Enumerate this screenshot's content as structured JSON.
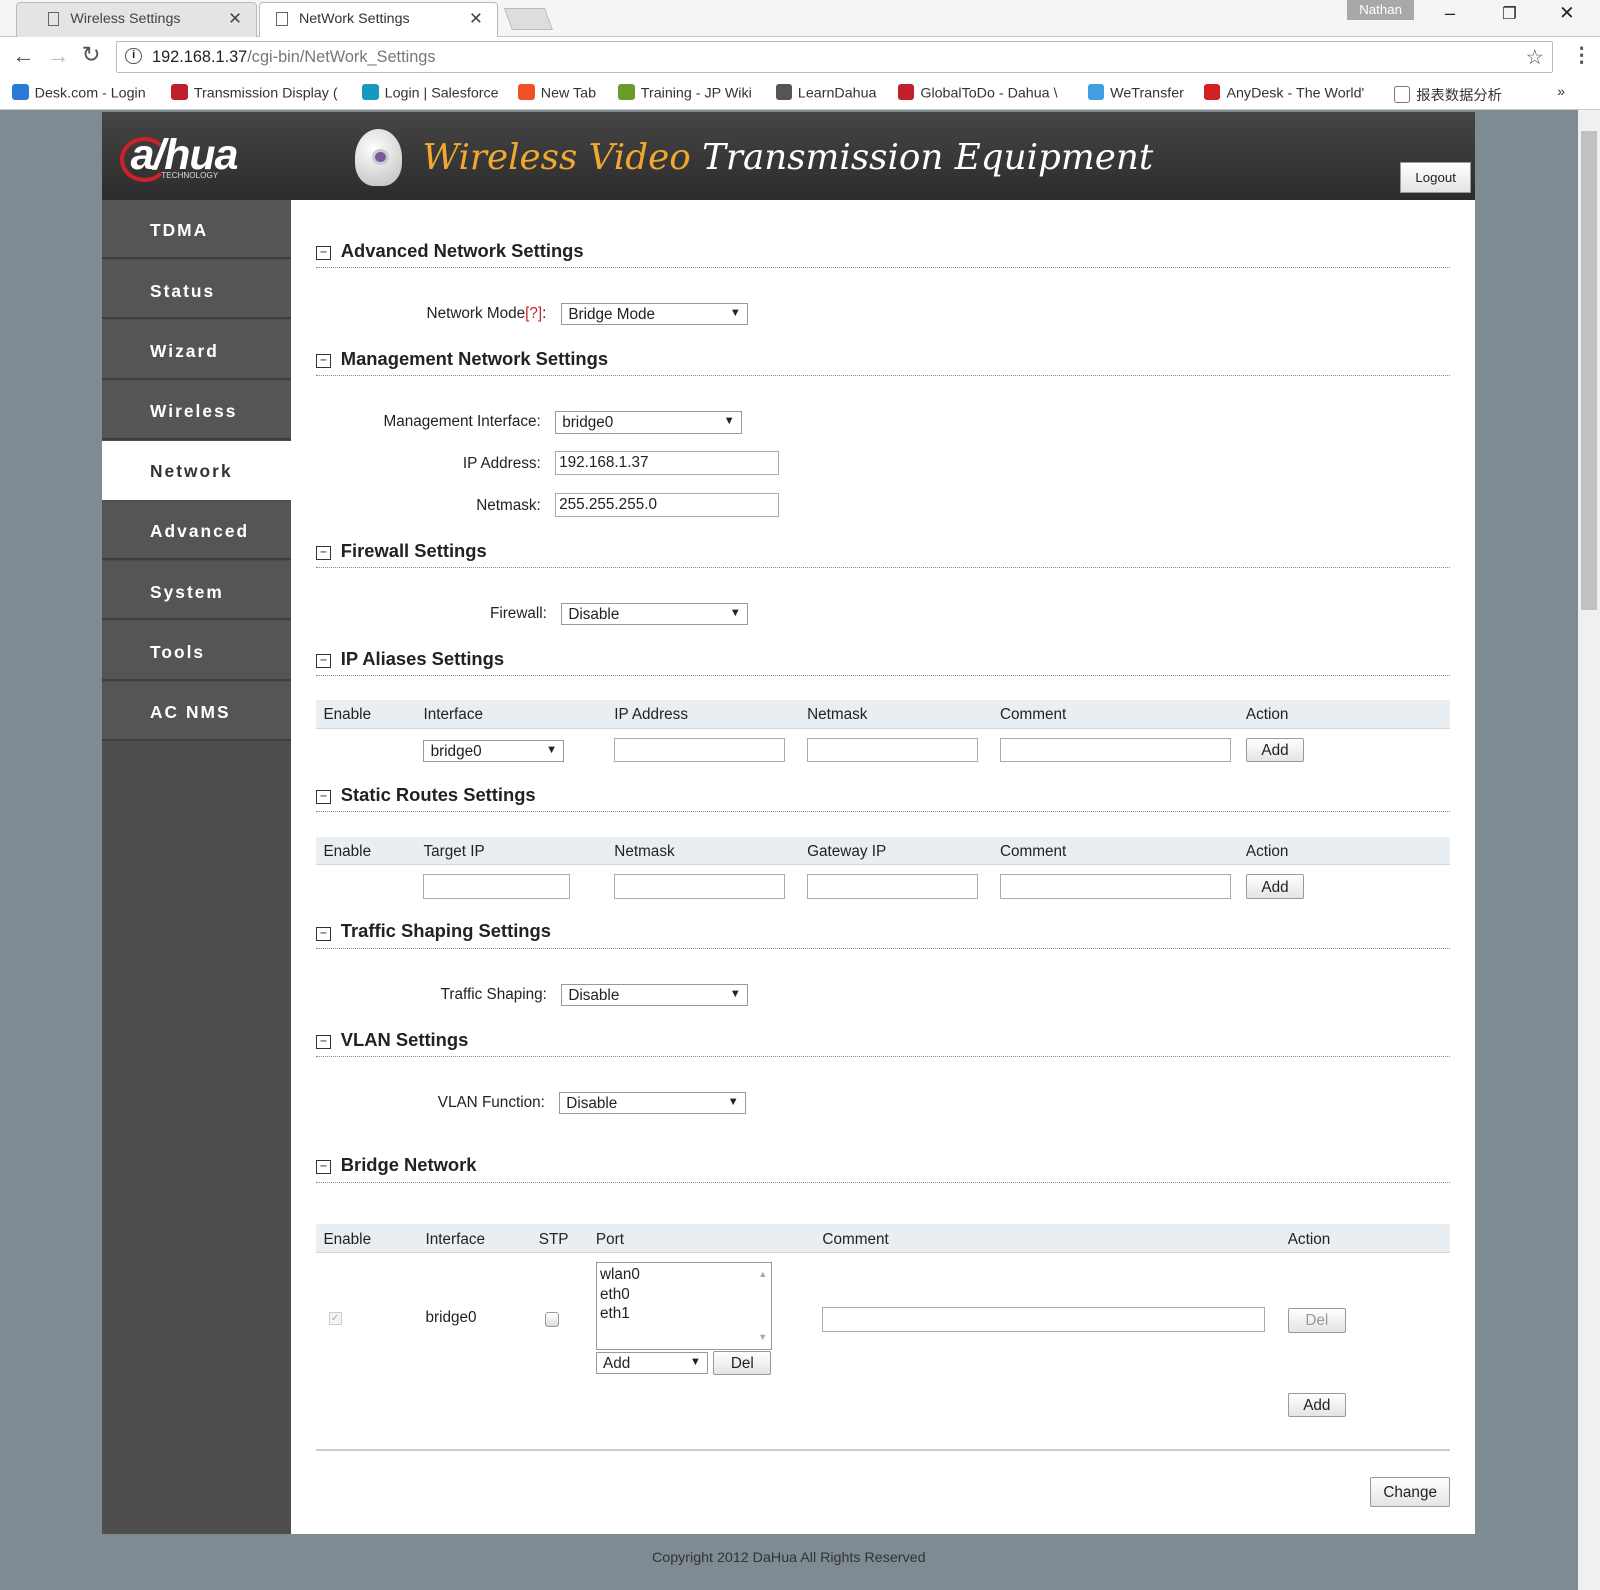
{
  "browser": {
    "tabs": [
      {
        "title": "Wireless Settings",
        "active": false
      },
      {
        "title": "NetWork Settings",
        "active": true
      }
    ],
    "profile": "Nathan",
    "url_host": "192.168.1.37",
    "url_path": "/cgi-bin/NetWork_Settings",
    "bookmarks": [
      {
        "label": "Desk.com - Login",
        "color": "#2b7bd6"
      },
      {
        "label": "Transmission Display (",
        "color": "#c0202a"
      },
      {
        "label": "Login | Salesforce",
        "color": "#1798c1"
      },
      {
        "label": "New Tab",
        "color": "#f25022"
      },
      {
        "label": "Training - JP Wiki",
        "color": "#6a9b2a"
      },
      {
        "label": "LearnDahua",
        "color": "#555555"
      },
      {
        "label": "GlobalToDo - Dahua \\",
        "color": "#c0202a"
      },
      {
        "label": "WeTransfer",
        "color": "#409fe0"
      },
      {
        "label": "AnyDesk - The World'",
        "color": "#d22020"
      },
      {
        "label": "报表数据分析",
        "color": "#ffffff"
      }
    ],
    "more": "»"
  },
  "header": {
    "logo": "alhua",
    "logo_sub": "TECHNOLOGY",
    "title_a": "Wireless Video",
    "title_b": "Transmission Equipment",
    "logout": "Logout",
    "accent": "#f0a830"
  },
  "sidebar": {
    "items": [
      {
        "label": "TDMA"
      },
      {
        "label": "Status"
      },
      {
        "label": "Wizard"
      },
      {
        "label": "Wireless"
      },
      {
        "label": "Network",
        "active": true
      },
      {
        "label": "Advanced"
      },
      {
        "label": "System"
      },
      {
        "label": "Tools"
      },
      {
        "label": "AC NMS"
      }
    ]
  },
  "sections": {
    "advanced": {
      "title": "Advanced Network Settings",
      "mode_label": "Network Mode",
      "help": "[?]",
      "colon": ":",
      "mode_value": "Bridge Mode"
    },
    "management": {
      "title": "Management Network Settings",
      "iface_label": "Management Interface:",
      "iface_value": "bridge0",
      "ip_label": "IP Address:",
      "ip_value": "192.168.1.37",
      "mask_label": "Netmask:",
      "mask_value": "255.255.255.0"
    },
    "firewall": {
      "title": "Firewall Settings",
      "label": "Firewall:",
      "value": "Disable"
    },
    "aliases": {
      "title": "IP Aliases Settings",
      "columns": [
        "Enable",
        "Interface",
        "IP Address",
        "Netmask",
        "Comment",
        "Action"
      ],
      "iface_value": "bridge0",
      "add": "Add"
    },
    "routes": {
      "title": "Static Routes Settings",
      "columns": [
        "Enable",
        "Target IP",
        "Netmask",
        "Gateway IP",
        "Comment",
        "Action"
      ],
      "add": "Add"
    },
    "traffic": {
      "title": "Traffic Shaping Settings",
      "label": "Traffic Shaping:",
      "value": "Disable"
    },
    "vlan": {
      "title": "VLAN Settings",
      "label": "VLAN Function:",
      "value": "Disable"
    },
    "bridge": {
      "title": "Bridge Network",
      "columns": [
        "Enable",
        "Interface",
        "STP",
        "Port",
        "Comment",
        "Action"
      ],
      "row": {
        "enabled": true,
        "interface": "bridge0",
        "stp": false,
        "ports": [
          "wlan0",
          "eth0",
          "eth1"
        ],
        "port_action": "Add",
        "port_del": "Del",
        "del": "Del"
      },
      "add": "Add"
    }
  },
  "change": "Change",
  "footer": "Copyright 2012 DaHua All Rights Reserved"
}
